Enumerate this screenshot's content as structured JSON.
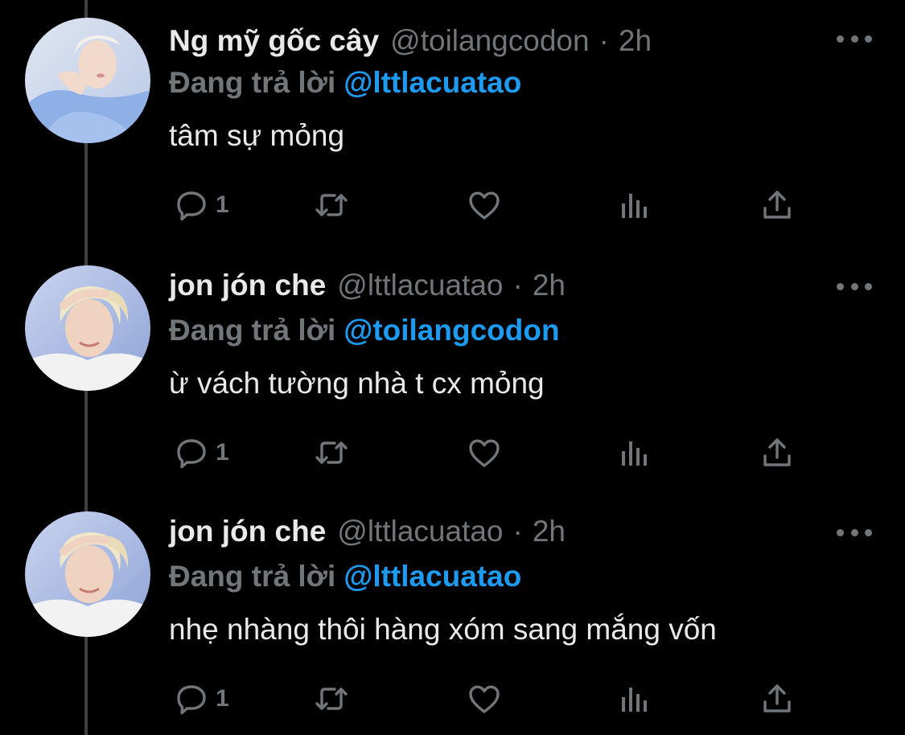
{
  "tweets": [
    {
      "display_name": "Ng mỹ gốc cây",
      "handle": "@toilangcodon",
      "separator": "·",
      "time": "2h",
      "reply_prefix": "Đang trả lời",
      "reply_to": "@lttlacuatao",
      "text": "tâm sự mỏng",
      "reply_count": "1",
      "avatar": "avatar-photo-blue-shirt"
    },
    {
      "display_name": "jon jón che",
      "handle": "@lttlacuatao",
      "separator": "·",
      "time": "2h",
      "reply_prefix": "Đang trả lời",
      "reply_to": "@toilangcodon",
      "text": "ừ vách tường nhà t cx mỏng",
      "reply_count": "1",
      "avatar": "avatar-photo-blonde"
    },
    {
      "display_name": "jon jón che",
      "handle": "@lttlacuatao",
      "separator": "·",
      "time": "2h",
      "reply_prefix": "Đang trả lời",
      "reply_to": "@lttlacuatao",
      "text": "nhẹ nhàng thôi hàng xóm sang mắng vốn",
      "reply_count": "1",
      "avatar": "avatar-photo-blonde"
    }
  ],
  "icons": {
    "reply": "comment-icon",
    "retweet": "retweet-icon",
    "like": "heart-icon",
    "views": "bar-chart-icon",
    "share": "share-icon",
    "more": "more-dots-icon"
  },
  "colors": {
    "background": "#000000",
    "primary_text": "#e7e9ea",
    "secondary_text": "#71767b",
    "mention": "#1d9bf0",
    "thread_line": "#3e4144"
  }
}
